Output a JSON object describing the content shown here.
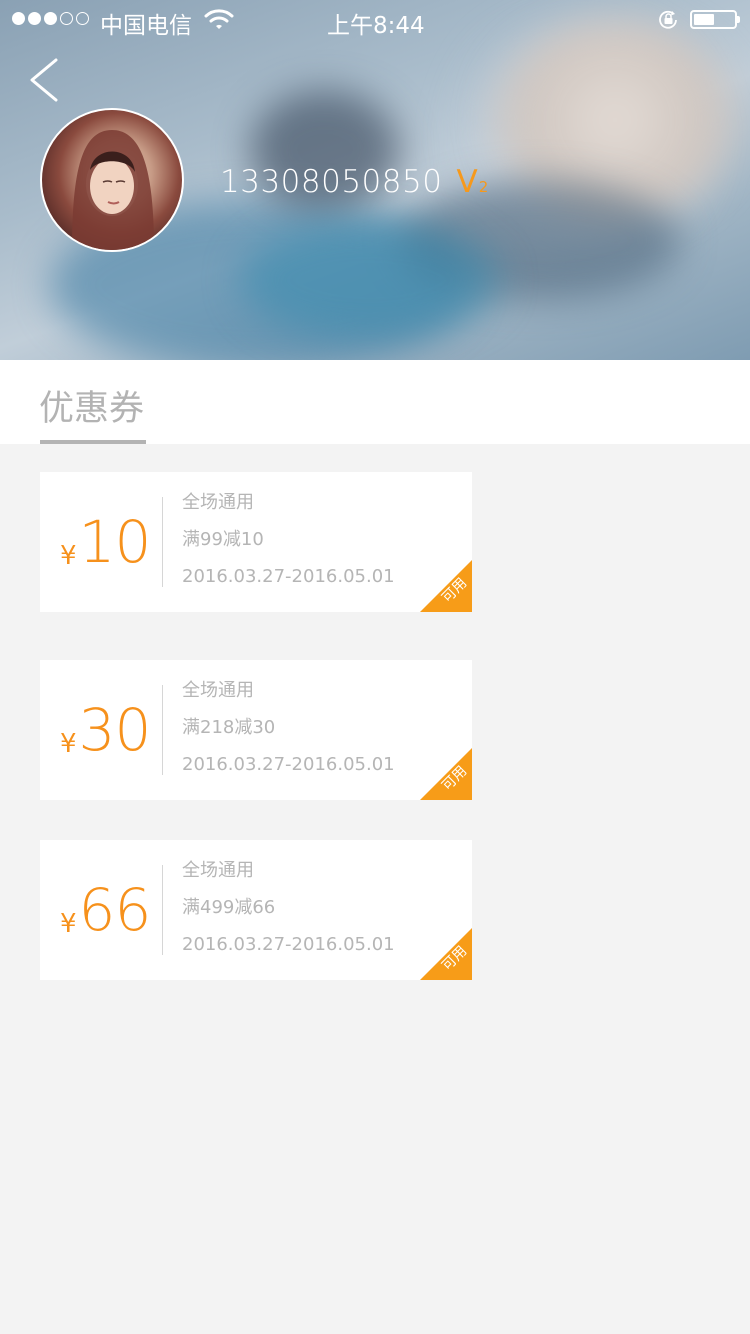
{
  "status_bar": {
    "carrier": "中国电信",
    "time": "上午8:44",
    "signal_bars_filled": 3,
    "signal_bars_total": 5
  },
  "profile": {
    "phone": "13308050850",
    "vip_label": "V",
    "vip_level": "2"
  },
  "section": {
    "title": "优惠券"
  },
  "coupons": [
    {
      "currency": "¥",
      "amount": "10",
      "scope": "全场通用",
      "rule": "满99减10",
      "period": "2016.03.27-2016.05.01",
      "status": "可用"
    },
    {
      "currency": "¥",
      "amount": "30",
      "scope": "全场通用",
      "rule": "满218减30",
      "period": "2016.03.27-2016.05.01",
      "status": "可用"
    },
    {
      "currency": "¥",
      "amount": "66",
      "scope": "全场通用",
      "rule": "满499减66",
      "period": "2016.03.27-2016.05.01",
      "status": "可用"
    }
  ],
  "colors": {
    "accent": "#f6911c",
    "corner": "#f79c18",
    "muted_text": "#b5b5b5",
    "page_bg": "#f3f3f3"
  },
  "icons": [
    "back-chevron-icon",
    "wifi-icon",
    "rotation-lock-icon",
    "battery-icon"
  ]
}
